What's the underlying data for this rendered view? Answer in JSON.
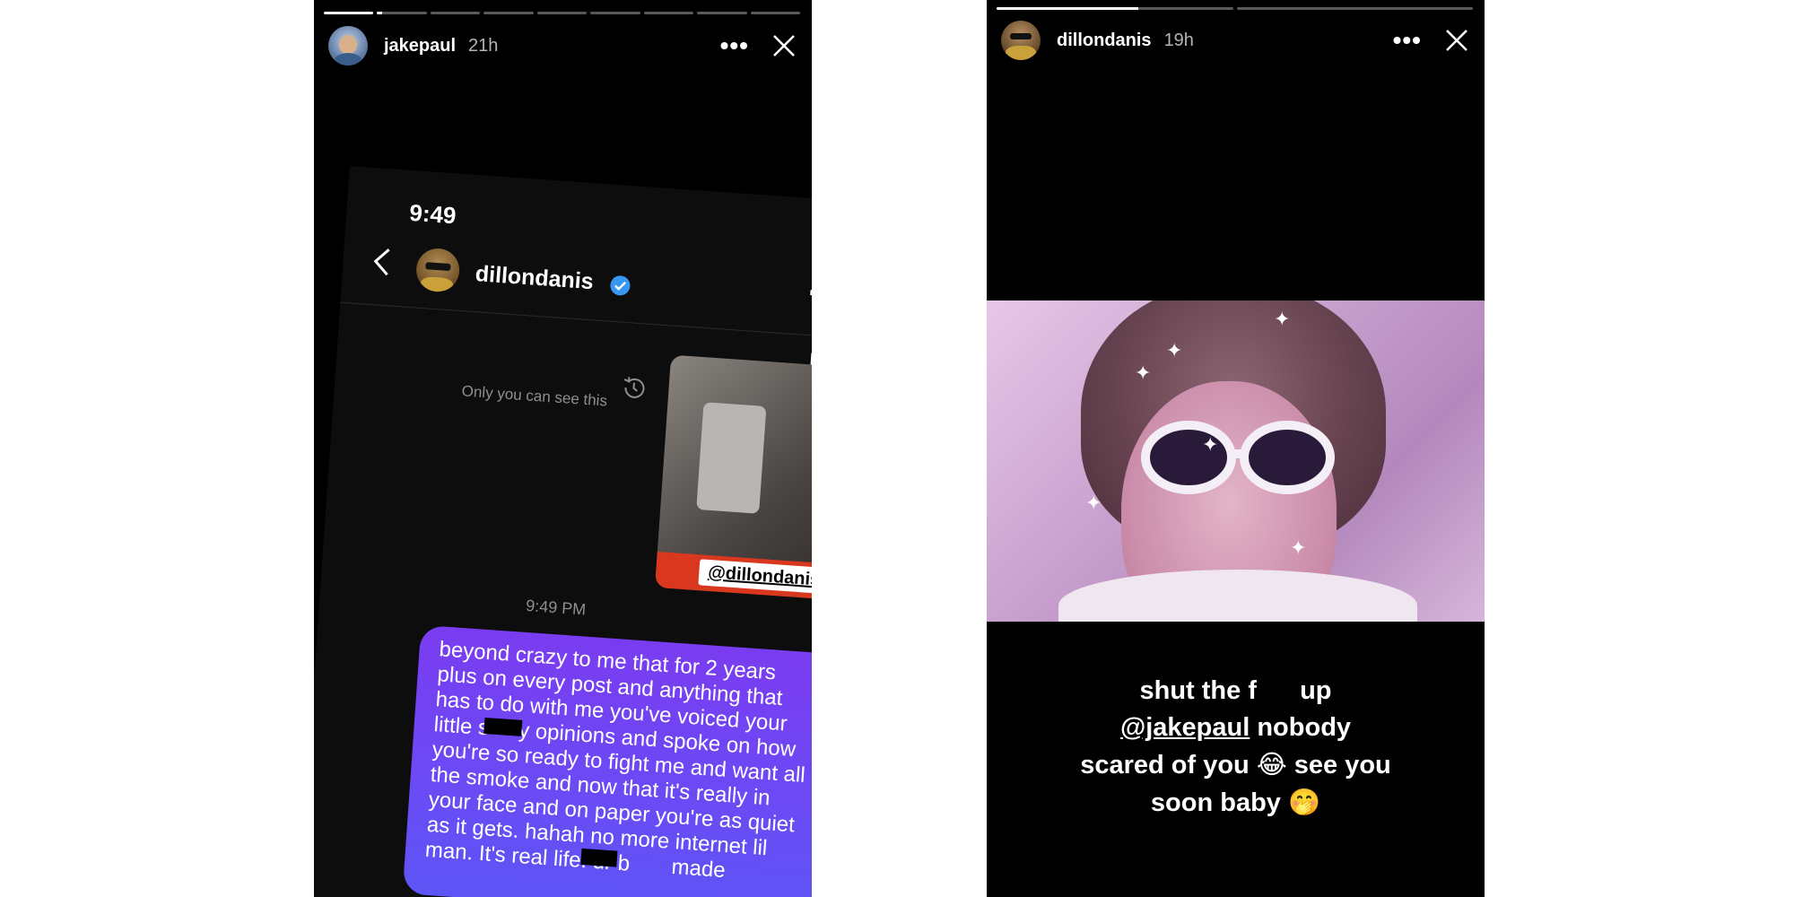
{
  "story1": {
    "progress": [
      1,
      0.1,
      0,
      0,
      0,
      0,
      0,
      0,
      0
    ],
    "username": "jakepaul",
    "time": "21h",
    "more_icon": "more-horizontal-icon",
    "close_icon": "close-icon",
    "screenshot": {
      "status_time": "9:49",
      "dm_username": "dillondanis",
      "only_you_text": "Only you can see this",
      "mention_tag": "@dillondanis",
      "message_time": "9:49 PM",
      "message_lines": [
        "beyond crazy to me that for 2 years",
        "plus on every post and anything that",
        "has to do with me you've voiced your",
        "little s     y opinions and spoke on how",
        "you're so ready to fight me and want all",
        "the smoke and now that it's really in",
        "your face and on paper you're as quiet",
        "as it gets. hahah no more internet lil",
        "man. It's real life. ur b       made"
      ]
    }
  },
  "story2": {
    "progress": [
      0.6,
      0
    ],
    "username": "dillondanis",
    "time": "19h",
    "caption": {
      "line1_a": "shut the f",
      "line1_b": "up",
      "mention": "@jakepaul",
      "line2_rest": " nobody",
      "line3_a": "scared of you ",
      "line3_emoji": "😂",
      "line3_b": " see you",
      "line4_a": "soon baby ",
      "line4_emoji": "🤭"
    }
  },
  "colors": {
    "bubble": "#6a4bf5",
    "story_bg": "#000000",
    "verified": "#3897f0"
  }
}
